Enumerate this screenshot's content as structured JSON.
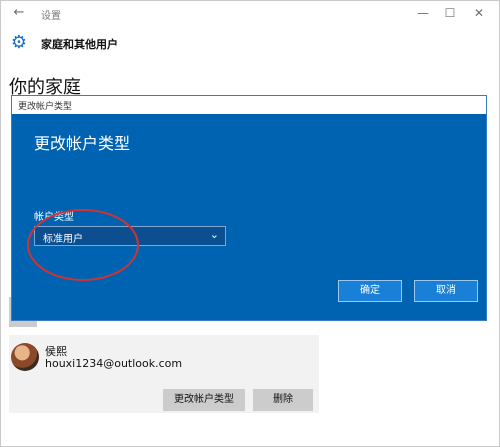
{
  "window": {
    "title": "设置",
    "back_icon": "arrow-left-icon",
    "minimize_icon": "minimize-icon",
    "maximize_icon": "maximize-icon",
    "close_icon": "close-icon"
  },
  "header": {
    "icon": "gear-icon",
    "title": "家庭和其他用户"
  },
  "page": {
    "heading": "你的家庭"
  },
  "user_card": {
    "name": "侯熙",
    "email": "houxi1234@outlook.com",
    "change_type_label": "更改帐户类型",
    "delete_label": "删除"
  },
  "dialog": {
    "window_title": "更改帐户类型",
    "heading": "更改帐户类型",
    "field_label": "帐户类型",
    "selected_value": "标准用户",
    "ok_label": "确定",
    "cancel_label": "取消"
  },
  "colors": {
    "dialog_bg": "#0063b1",
    "accent": "#1a6fc4",
    "annotation": "#d23232"
  }
}
